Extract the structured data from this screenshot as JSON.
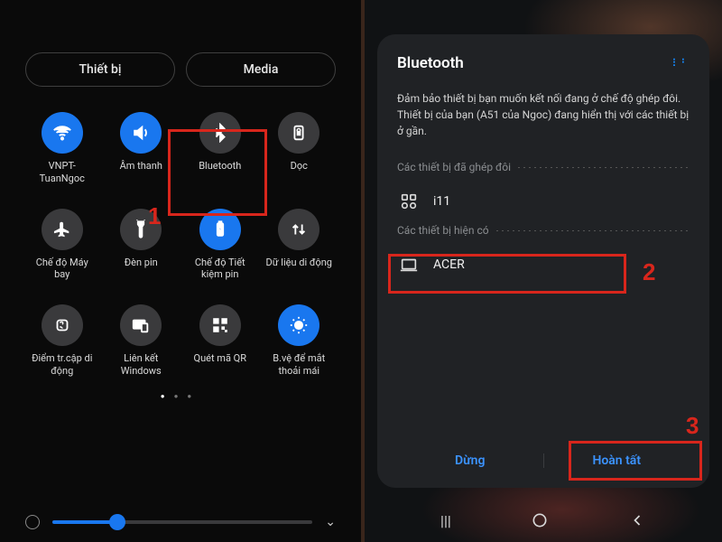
{
  "left": {
    "tabs": {
      "device": "Thiết bị",
      "media": "Media"
    },
    "tiles": [
      {
        "label": "VNPT-TuanNgoc",
        "icon": "wifi",
        "active": true
      },
      {
        "label": "Âm thanh",
        "icon": "sound",
        "active": true
      },
      {
        "label": "Bluetooth",
        "icon": "bluetooth",
        "active": false
      },
      {
        "label": "Dọc",
        "icon": "lock-rotate",
        "active": false
      },
      {
        "label": "Chế độ Máy bay",
        "icon": "airplane",
        "active": false
      },
      {
        "label": "Đèn pin",
        "icon": "flashlight",
        "active": false
      },
      {
        "label": "Chế độ Tiết kiệm pin",
        "icon": "battery-saver",
        "active": true
      },
      {
        "label": "Dữ liệu di động",
        "icon": "data",
        "active": false
      },
      {
        "label": "Điểm tr.cập di động",
        "icon": "hotspot",
        "active": false
      },
      {
        "label": "Liên kết Windows",
        "icon": "link-windows",
        "active": false
      },
      {
        "label": "Quét mã QR",
        "icon": "qr",
        "active": false
      },
      {
        "label": "B.vệ để mắt thoải mái",
        "icon": "eye-comfort",
        "active": true
      }
    ],
    "page_dots": {
      "total": 3,
      "active": 0
    },
    "brightness_pct": 25
  },
  "right": {
    "title": "Bluetooth",
    "description": "Đảm bảo thiết bị bạn muốn kết nối đang ở chế độ ghép đôi. Thiết bị của bạn (A51 của Ngoc) đang hiển thị với các thiết bị ở gần.",
    "section_paired": "Các thiết bị đã ghép đôi",
    "section_available": "Các thiết bị hiện có",
    "paired_devices": [
      {
        "name": "i11",
        "icon": "earbuds"
      }
    ],
    "available_devices": [
      {
        "name": "ACER",
        "icon": "laptop"
      }
    ],
    "actions": {
      "stop": "Dừng",
      "done": "Hoàn tất"
    }
  },
  "annotations": {
    "step1": "1",
    "step2": "2",
    "step3": "3"
  }
}
